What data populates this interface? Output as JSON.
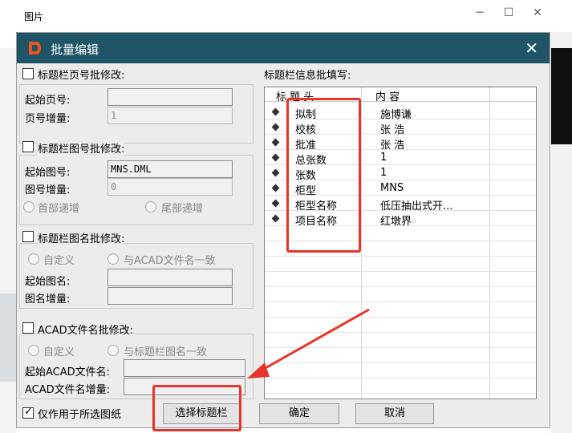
{
  "window": {
    "title": "图片",
    "minimize": "─",
    "maximize": "☐",
    "close": "✕"
  },
  "dialog": {
    "title": "批量编辑",
    "close": "✕"
  },
  "page_group": {
    "title": "标题栏页号批修改:",
    "start_label": "起始页号:",
    "start_value": "",
    "inc_label": "页号增量:",
    "inc_value": "1"
  },
  "figno_group": {
    "title": "标题栏图号批修改:",
    "start_label": "起始图号:",
    "start_value": "MNS.DML",
    "inc_label": "图号增量:",
    "inc_value": "0",
    "radio_head": "首部递增",
    "radio_tail": "尾部递增"
  },
  "figname_group": {
    "title": "标题栏图名批修改:",
    "radio_custom": "自定义",
    "radio_acad": "与ACAD文件名一致",
    "start_label": "起始图名:",
    "start_value": "",
    "inc_label": "图名增量:",
    "inc_value": ""
  },
  "acad_group": {
    "title": "ACAD文件名批修改:",
    "radio_custom": "自定义",
    "radio_title": "与标题栏图名一致",
    "start_label": "起始ACAD文件名:",
    "start_value": "",
    "inc_label": "ACAD文件名增量:",
    "inc_value": ""
  },
  "only_selected_label": "仅作用于所选图纸",
  "buttons": {
    "select_title": "选择标题栏",
    "ok": "确定",
    "cancel": "取消"
  },
  "info": {
    "title": "标题栏信息批填写:",
    "col_head": "标 题 头",
    "col_content": "内  容",
    "rows": [
      {
        "head": "拟制",
        "content": "施博谦"
      },
      {
        "head": "校核",
        "content": "张  浩"
      },
      {
        "head": "批准",
        "content": "张  浩"
      },
      {
        "head": "总张数",
        "content": "1"
      },
      {
        "head": "张数",
        "content": "1"
      },
      {
        "head": "柜型",
        "content": "MNS"
      },
      {
        "head": "柜型名称",
        "content": "低压抽出式开..."
      },
      {
        "head": "项目名称",
        "content": "红墩界"
      }
    ]
  },
  "colors": {
    "title_bar": "#1f5566",
    "highlight": "#e8332a",
    "logo": "#e8541e"
  }
}
